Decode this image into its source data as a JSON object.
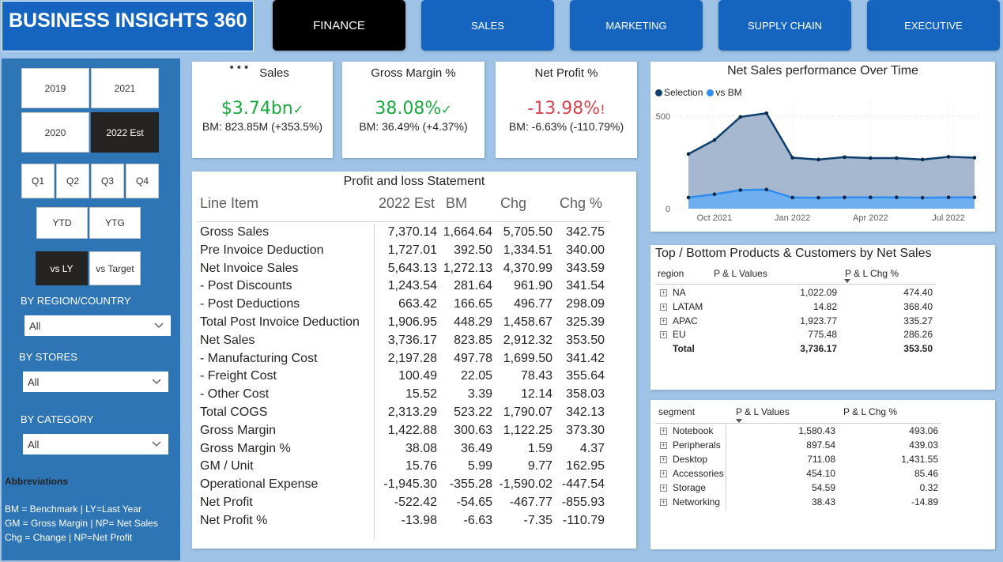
{
  "brand": {
    "title": "BUSINESS INSIGHTS 360"
  },
  "nav": [
    {
      "label": "FINANCE",
      "active": true
    },
    {
      "label": "SALES",
      "active": false
    },
    {
      "label": "MARKETING",
      "active": false
    },
    {
      "label": "SUPPLY CHAIN",
      "active": false
    },
    {
      "label": "EXECUTIVE",
      "active": false
    }
  ],
  "filters": {
    "years": [
      "2019",
      "2021",
      "2020",
      "2022 Est"
    ],
    "selected_year": "2022 Est",
    "quarters": [
      "Q1",
      "Q2",
      "Q3",
      "Q4"
    ],
    "periods": [
      "YTD",
      "YTG"
    ],
    "compare": [
      "vs LY",
      "vs Target"
    ],
    "selected_compare": "vs LY",
    "region_label": "BY REGION/COUNTRY",
    "region_value": "All",
    "stores_label": "BY STORES",
    "stores_value": "All",
    "category_label": "BY CATEGORY",
    "category_value": "All"
  },
  "abbreviations": {
    "title": "Abbreviations",
    "lines": [
      "BM = Benchmark | LY=Last Year",
      "GM = Gross Margin | NP= Net Sales",
      "Chg = Change | NP=Net Profit"
    ]
  },
  "kpis": [
    {
      "title": "Sales",
      "value": "$3.74bn",
      "bm": "BM: 823.85M (+353.5%)",
      "status": "✓",
      "color": "#1aab40"
    },
    {
      "title": "Gross Margin %",
      "value": "38.08%",
      "bm": "BM: 36.49% (+4.37%)",
      "status": "✓",
      "color": "#1aab40"
    },
    {
      "title": "Net Profit %",
      "value": "-13.98%",
      "bm": "BM: -6.63% (-110.79%)",
      "status": "!",
      "color": "#d64550"
    }
  ],
  "kpi_more": "•••",
  "pl": {
    "title": "Profit and loss Statement",
    "headers": [
      "Line Item",
      "2022 Est",
      "BM",
      "Chg",
      "Chg %"
    ],
    "rows": [
      [
        "Gross Sales",
        "7,370.14",
        "1,664.64",
        "5,705.50",
        "342.75"
      ],
      [
        "Pre Invoice Deduction",
        "1,727.01",
        "392.50",
        "1,334.51",
        "340.00"
      ],
      [
        "Net Invoice Sales",
        "5,643.13",
        "1,272.13",
        "4,370.99",
        "343.59"
      ],
      [
        "- Post Discounts",
        "1,243.54",
        "281.64",
        "961.90",
        "341.54"
      ],
      [
        "- Post Deductions",
        "663.42",
        "166.65",
        "496.77",
        "298.09"
      ],
      [
        "Total Post Invoice Deduction",
        "1,906.95",
        "448.29",
        "1,458.67",
        "325.39"
      ],
      [
        "Net Sales",
        "3,736.17",
        "823.85",
        "2,912.32",
        "353.50"
      ],
      [
        "- Manufacturing Cost",
        "2,197.28",
        "497.78",
        "1,699.50",
        "341.42"
      ],
      [
        "- Freight Cost",
        "100.49",
        "22.05",
        "78.43",
        "355.64"
      ],
      [
        "- Other Cost",
        "15.52",
        "3.39",
        "12.14",
        "358.03"
      ],
      [
        "Total COGS",
        "2,313.29",
        "523.22",
        "1,790.07",
        "342.13"
      ],
      [
        "Gross Margin",
        "1,422.88",
        "300.63",
        "1,122.25",
        "373.30"
      ],
      [
        "Gross Margin %",
        "38.08",
        "36.49",
        "1.59",
        "4.37"
      ],
      [
        "GM / Unit",
        "15.76",
        "5.99",
        "9.77",
        "162.95"
      ],
      [
        "Operational Expense",
        "-1,945.30",
        "-355.28",
        "-1,590.02",
        "-447.54"
      ],
      [
        "Net Profit",
        "-522.42",
        "-54.65",
        "-467.77",
        "-855.93"
      ],
      [
        "Net Profit %",
        "-13.98",
        "-6.63",
        "-7.35",
        "-110.79"
      ]
    ]
  },
  "chart_data": {
    "type": "area",
    "title": "Net Sales performance Over Time",
    "legend": [
      "Selection",
      "vs BM"
    ],
    "legend_position": "top-left",
    "x_ticks": [
      "Oct 2021",
      "Jan 2022",
      "Apr 2022",
      "Jul 2022"
    ],
    "y_ticks": [
      "500",
      "0"
    ],
    "ylim": [
      0,
      580
    ],
    "x": [
      "Sep 2021",
      "Oct 2021",
      "Nov 2021",
      "Dec 2021",
      "Jan 2022",
      "Feb 2022",
      "Mar 2022",
      "Apr 2022",
      "May 2022",
      "Jun 2022",
      "Jul 2022",
      "Aug 2022"
    ],
    "series": [
      {
        "name": "Selection",
        "color": "#0d3f6e",
        "values": [
          295,
          370,
          495,
          515,
          275,
          265,
          278,
          273,
          273,
          265,
          280,
          275
        ]
      },
      {
        "name": "vs BM",
        "color": "#2f8cf0",
        "values": [
          60,
          78,
          100,
          103,
          60,
          59,
          61,
          61,
          61,
          59,
          61,
          61
        ]
      }
    ]
  },
  "region_table": {
    "title": "Top / Bottom Products & Customers by Net Sales",
    "headers": [
      "region",
      "P & L Values",
      "P & L Chg %"
    ],
    "rows": [
      [
        "NA",
        "1,022.09",
        "474.40"
      ],
      [
        "LATAM",
        "14.82",
        "368.40"
      ],
      [
        "APAC",
        "1,923.77",
        "335.27"
      ],
      [
        "EU",
        "775.48",
        "286.26"
      ]
    ],
    "total": [
      "Total",
      "3,736.17",
      "353.50"
    ]
  },
  "segment_table": {
    "headers": [
      "segment",
      "P & L Values",
      "P & L Chg %"
    ],
    "rows": [
      [
        "Notebook",
        "1,580.43",
        "493.06"
      ],
      [
        "Peripherals",
        "897.54",
        "439.03"
      ],
      [
        "Desktop",
        "711.08",
        "1,431.55"
      ],
      [
        "Accessories",
        "454.10",
        "85.46"
      ],
      [
        "Storage",
        "54.59",
        "0.32"
      ],
      [
        "Networking",
        "38.43",
        "-14.89"
      ]
    ]
  }
}
